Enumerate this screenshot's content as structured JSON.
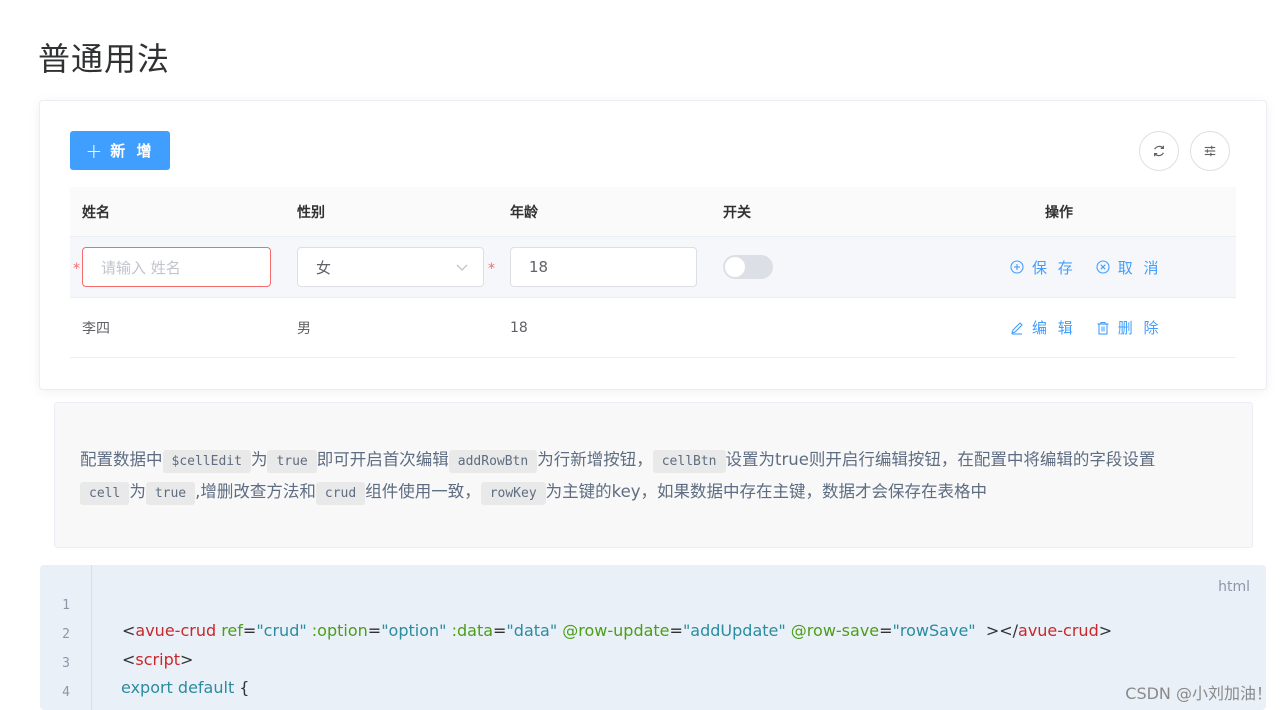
{
  "page": {
    "title": "普通用法"
  },
  "toolbar": {
    "add_label": "新 增",
    "refresh_icon": "refresh-icon",
    "columns_icon": "sliders-icon"
  },
  "table": {
    "headers": [
      "姓名",
      "性别",
      "年龄",
      "开关",
      "操作"
    ],
    "edit_row": {
      "name_placeholder": "请输入 姓名",
      "gender_value": "女",
      "age_value": "18",
      "switch_on": false,
      "save_label": "保 存",
      "cancel_label": "取 消"
    },
    "rows": [
      {
        "name": "李四",
        "gender": "男",
        "age": "18",
        "edit_label": "编 辑",
        "delete_label": "删 除"
      }
    ]
  },
  "description": {
    "t1": "配置数据中",
    "c1": "$cellEdit",
    "t2": "为",
    "c2": "true",
    "t3": "即可开启首次编辑",
    "c3": "addRowBtn",
    "t4": "为行新增按钮，",
    "c4": "cellBtn",
    "t5": "设置为true则开启行编辑按钮，在配置中将编辑的字段设置",
    "c5": "cell",
    "t6": "为",
    "c6": "true",
    "t7": ",增删改查方法和",
    "c7": "crud",
    "t8": "组件使用一致，",
    "c8": "rowKey",
    "t9": "为主键的key，如果数据中存在主键，数据才会保存在表格中"
  },
  "code": {
    "lang": "html",
    "line_numbers": [
      "1",
      "2",
      "3",
      "4"
    ],
    "line2": {
      "open": "<",
      "tag": "avue-crud",
      "a1": " ref",
      "v1": "\"crud\"",
      "a2": " :option",
      "v2": "\"option\"",
      "a3": " :data",
      "v3": "\"data\"",
      "a4": " @row-update",
      "v4": "\"addUpdate\"",
      "a5": " @row-save",
      "v5": "\"rowSave\"",
      "mid": "  ></",
      "close": ">"
    },
    "line3": {
      "open": "<",
      "tag": "script",
      "close": ">"
    },
    "line4": {
      "kw": "export default",
      "rest": " {"
    }
  },
  "watermark": "CSDN @小刘加油！"
}
